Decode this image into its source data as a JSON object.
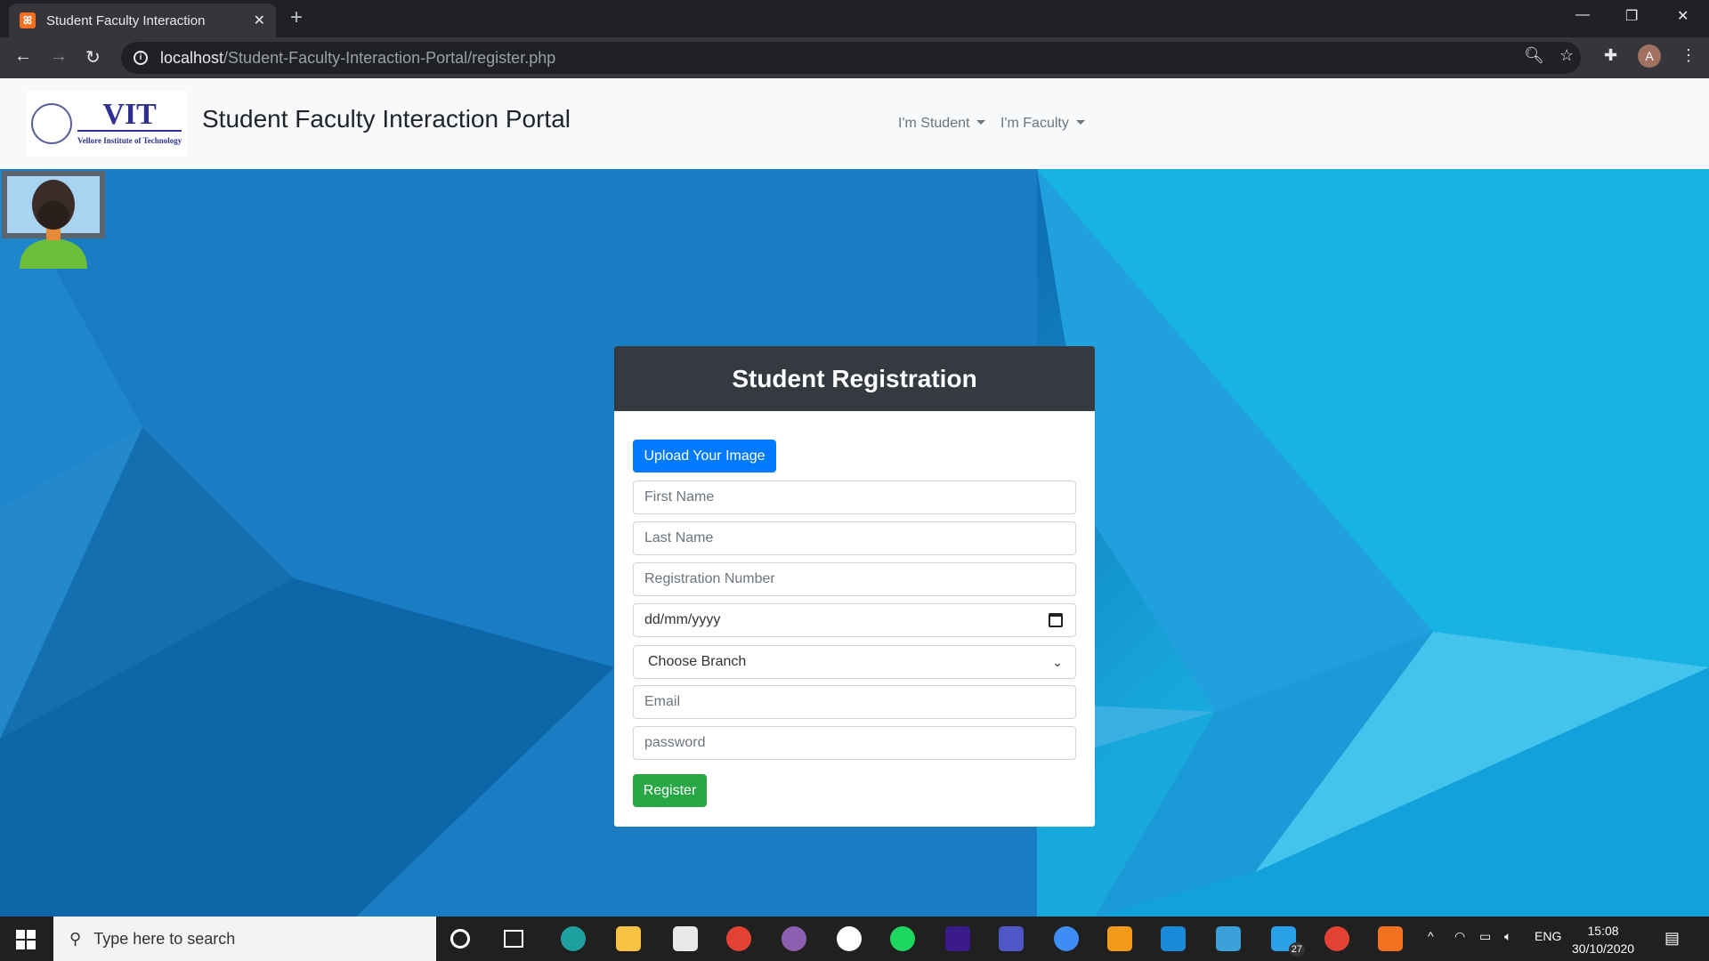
{
  "browser": {
    "tab_title": "Student Faculty Interaction",
    "url_host": "localhost",
    "url_path": "/Student-Faculty-Interaction-Portal/register.php",
    "profile_initial": "A"
  },
  "navbar": {
    "brand": "Student Faculty Interaction Portal",
    "logo_text": "VIT",
    "logo_subtitle": "Vellore Institute of Technology",
    "menus": [
      "I'm Student",
      "I'm Faculty"
    ]
  },
  "form": {
    "title": "Student Registration",
    "upload_label": "Upload Your Image",
    "fields": {
      "first_name": "First Name",
      "last_name": "Last Name",
      "reg_no": "Registration Number",
      "dob": "dd/mm/yyyy",
      "branch": "Choose Branch",
      "email": "Email",
      "password": "password"
    },
    "submit_label": "Register"
  },
  "taskbar": {
    "search_placeholder": "Type here to search",
    "language": "ENG",
    "time": "15:08",
    "date": "30/10/2020",
    "badge": "27"
  },
  "colors": {
    "primary": "#007bff",
    "success": "#28a745",
    "card_header": "#343a40"
  }
}
